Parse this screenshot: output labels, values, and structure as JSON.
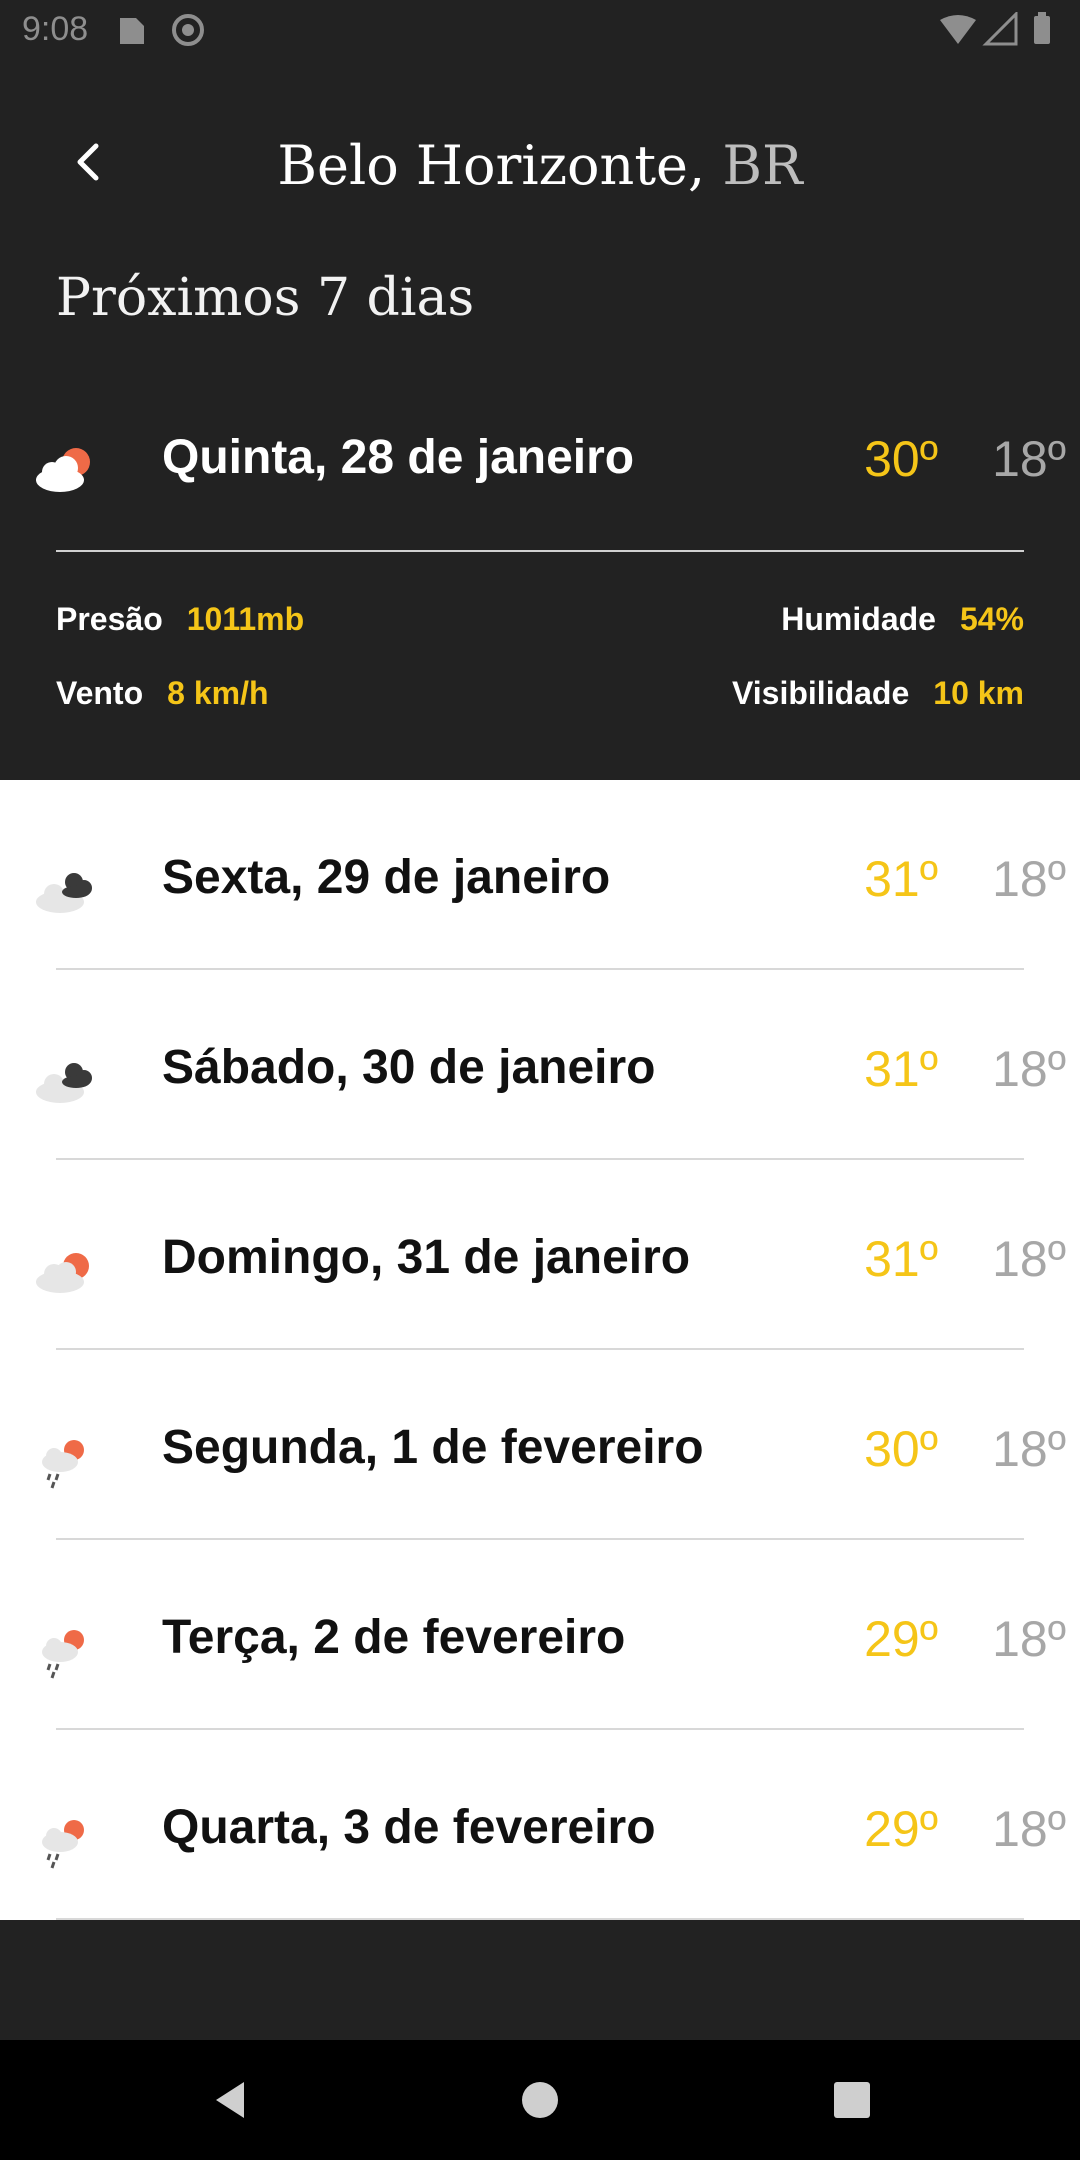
{
  "status_bar": {
    "time": "9:08"
  },
  "header": {
    "city": "Belo Horizonte",
    "separator": ",",
    "country": "BR"
  },
  "subtitle": "Próximos 7 dias",
  "today": {
    "label": "Quinta, 28 de janeiro",
    "max": "30º",
    "min": "18º",
    "icon": "partly-cloudy-sun-icon",
    "details": {
      "pressure_label": "Presão",
      "pressure_value": "1011mb",
      "humidity_label": "Humidade",
      "humidity_value": "54%",
      "wind_label": "Vento",
      "wind_value": "8 km/h",
      "visibility_label": "Visibilidade",
      "visibility_value": "10 km"
    }
  },
  "forecast": [
    {
      "label": "Sexta, 29 de janeiro",
      "max": "31º",
      "min": "18º",
      "icon": "cloudy-icon"
    },
    {
      "label": "Sábado, 30 de janeiro",
      "max": "31º",
      "min": "18º",
      "icon": "cloudy-icon"
    },
    {
      "label": "Domingo, 31 de janeiro",
      "max": "31º",
      "min": "18º",
      "icon": "partly-cloudy-sun-icon"
    },
    {
      "label": "Segunda, 1 de fevereiro",
      "max": "30º",
      "min": "18º",
      "icon": "rain-sun-icon"
    },
    {
      "label": "Terça, 2 de fevereiro",
      "max": "29º",
      "min": "18º",
      "icon": "rain-sun-icon"
    },
    {
      "label": "Quarta, 3 de fevereiro",
      "max": "29º",
      "min": "18º",
      "icon": "rain-sun-icon"
    }
  ],
  "colors": {
    "accent": "#f5c518",
    "sun": "#ef6a47",
    "dark_bg": "#222222",
    "muted": "#a7a7a7"
  }
}
